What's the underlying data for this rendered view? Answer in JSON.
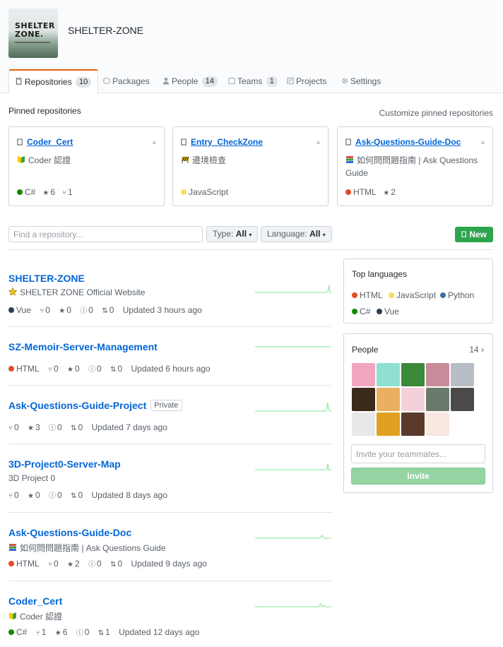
{
  "org": {
    "name": "SHELTER-ZONE",
    "logo_line1": "SHELTER",
    "logo_line2": "ZONE."
  },
  "tabs": [
    {
      "label": "Repositories",
      "count": "10"
    },
    {
      "label": "Packages",
      "count": ""
    },
    {
      "label": "People",
      "count": "14"
    },
    {
      "label": "Teams",
      "count": "1"
    },
    {
      "label": "Projects",
      "count": ""
    },
    {
      "label": "Settings",
      "count": ""
    }
  ],
  "pinned": {
    "title": "Pinned repositories",
    "customize_label": "Customize pinned repositories",
    "cards": [
      {
        "name": "Coder_Cert",
        "desc": "Coder 認證",
        "desc_icon": "beginner-badge-icon",
        "lang": "C#",
        "lang_color": "#178600",
        "stars": "6",
        "forks": "1"
      },
      {
        "name": "Entry_CheckZone",
        "desc": "邊境檢查",
        "desc_icon": "construction-icon",
        "lang": "JavaScript",
        "lang_color": "#f1e05a",
        "stars": "",
        "forks": ""
      },
      {
        "name": "Ask-Questions-Guide-Doc",
        "desc": "如何問問題指南 | Ask Questions Guide",
        "desc_icon": "books-icon",
        "lang": "HTML",
        "lang_color": "#e34c26",
        "stars": "2",
        "forks": ""
      }
    ]
  },
  "filters": {
    "search_placeholder": "Find a repository...",
    "type_label": "Type:",
    "type_value": "All",
    "language_label": "Language:",
    "language_value": "All",
    "new_label": "New"
  },
  "repos": [
    {
      "name": "SHELTER-ZONE",
      "private": "",
      "desc": "SHELTER ZONE Official Website",
      "desc_icon": "star-emoji-icon",
      "lang": "Vue",
      "lang_color": "#2c3e50",
      "forks": "0",
      "stars": "0",
      "issues": "0",
      "prs": "0",
      "updated": "Updated 3 hours ago"
    },
    {
      "name": "SZ-Memoir-Server-Management",
      "private": "",
      "desc": "",
      "desc_icon": "",
      "lang": "HTML",
      "lang_color": "#e34c26",
      "forks": "0",
      "stars": "0",
      "issues": "0",
      "prs": "0",
      "updated": "Updated 6 hours ago"
    },
    {
      "name": "Ask-Questions-Guide-Project",
      "private": "Private",
      "desc": "",
      "desc_icon": "",
      "lang": "",
      "lang_color": "",
      "forks": "0",
      "stars": "3",
      "issues": "0",
      "prs": "0",
      "updated": "Updated 7 days ago"
    },
    {
      "name": "3D-Project0-Server-Map",
      "private": "",
      "desc": "3D Project 0",
      "desc_icon": "",
      "lang": "",
      "lang_color": "",
      "forks": "0",
      "stars": "0",
      "issues": "0",
      "prs": "0",
      "updated": "Updated 8 days ago"
    },
    {
      "name": "Ask-Questions-Guide-Doc",
      "private": "",
      "desc": "如何問問題指南 | Ask Questions Guide",
      "desc_icon": "books-icon",
      "lang": "HTML",
      "lang_color": "#e34c26",
      "forks": "0",
      "stars": "2",
      "issues": "0",
      "prs": "0",
      "updated": "Updated 9 days ago"
    },
    {
      "name": "Coder_Cert",
      "private": "",
      "desc": "Coder 認證",
      "desc_icon": "beginner-badge-icon",
      "lang": "C#",
      "lang_color": "#178600",
      "forks": "1",
      "stars": "6",
      "issues": "0",
      "prs": "1",
      "updated": "Updated 12 days ago"
    }
  ],
  "top_languages": {
    "title": "Top languages",
    "items": [
      {
        "name": "HTML",
        "color": "#e34c26"
      },
      {
        "name": "JavaScript",
        "color": "#f1e05a"
      },
      {
        "name": "Python",
        "color": "#3572A5"
      },
      {
        "name": "C#",
        "color": "#178600"
      },
      {
        "name": "Vue",
        "color": "#2c3e50"
      }
    ]
  },
  "people": {
    "title": "People",
    "count": "14 ›",
    "invite_placeholder": "Invite your teammates...",
    "invite_label": "Invite",
    "avatar_colors": [
      "#f0a5c0",
      "#8fe0d0",
      "#3a8a3a",
      "#c98a9a",
      "#b8bcc4",
      "#3a2a1a",
      "#e8b060",
      "#f4d0d8",
      "#6a7a6a",
      "#4a4a4a",
      "#e8e8e8",
      "#e0a020",
      "#5a3a2a",
      "#f8e8e0"
    ]
  }
}
